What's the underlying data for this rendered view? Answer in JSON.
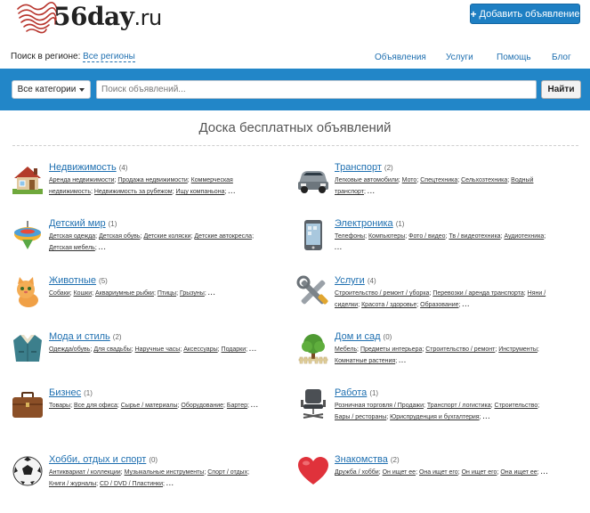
{
  "header": {
    "logo_text": "56day",
    "logo_tld": ".ru",
    "add_button": "Добавить объявление",
    "region_label": "Поиск в регионе:",
    "region_value": "Все регионы"
  },
  "nav": [
    "Объявления",
    "Услуги",
    "Помощь",
    "Блог"
  ],
  "search": {
    "category_button": "Все категории",
    "placeholder": "Поиск объявлений...",
    "submit": "Найти"
  },
  "page_title": "Доска бесплатных объявлений",
  "categories": [
    {
      "icon": "house-icon",
      "title": "Недвижимость",
      "count": "(4)",
      "subs": [
        "Аренда недвижимости",
        "Продажа недвижимости",
        "Коммерческая недвижимость",
        "Недвижимость за рубежом",
        "Ищу компаньона"
      ]
    },
    {
      "icon": "car-icon",
      "title": "Транспорт",
      "count": "(2)",
      "subs": [
        "Легковые автомобили",
        "Мото",
        "Спецтехника",
        "Сельхозтехника",
        "Водный транспорт"
      ]
    },
    {
      "icon": "spinning-top-icon",
      "title": "Детский мир",
      "count": "(1)",
      "subs": [
        "Детская одежда",
        "Детская обувь",
        "Детские коляски",
        "Детские автокресла",
        "Детская мебель"
      ]
    },
    {
      "icon": "smartphone-icon",
      "title": "Электроника",
      "count": "(1)",
      "subs": [
        "Телефоны",
        "Компьютеры",
        "Фото / видео",
        "Тв / видеотехника",
        "Аудиотехника"
      ]
    },
    {
      "icon": "kitten-icon",
      "title": "Животные",
      "count": "(5)",
      "subs": [
        "Собаки",
        "Кошки",
        "Аквариумные рыбки",
        "Птицы",
        "Грызуны"
      ]
    },
    {
      "icon": "tools-icon",
      "title": "Услуги",
      "count": "(4)",
      "subs": [
        "Строительство / ремонт / уборка",
        "Перевозки / аренда транспорта",
        "Няни / сиделки",
        "Красота / здоровье",
        "Образование"
      ]
    },
    {
      "icon": "jacket-icon",
      "title": "Мода и стиль",
      "count": "(2)",
      "subs": [
        "Одежда/обувь",
        "Для свадьбы",
        "Наручные часы",
        "Аксессуары",
        "Подарки"
      ]
    },
    {
      "icon": "tree-icon",
      "title": "Дом и сад",
      "count": "(0)",
      "subs": [
        "Мебель",
        "Предметы интерьера",
        "Строительство / ремонт",
        "Инструменты",
        "Комнатные растения"
      ]
    },
    {
      "icon": "briefcase-icon",
      "title": "Бизнес",
      "count": "(1)",
      "subs": [
        "Товары",
        "Все для офиса",
        "Сырье / материалы",
        "Оборудование",
        "Бартер"
      ]
    },
    {
      "icon": "office-chair-icon",
      "title": "Работа",
      "count": "(1)",
      "subs": [
        "Розничная торговля / Продажи",
        "Транспорт / логистика",
        "Строительство",
        "Бары / рестораны",
        "Юриспруденция и бухгалтерия"
      ]
    },
    {
      "icon": "soccer-ball-icon",
      "title": "Хобби, отдых и спорт",
      "count": "(0)",
      "subs": [
        "Антиквариат / коллекции",
        "Музыкальные инструменты",
        "Спорт / отдых",
        "Книги / журналы",
        "CD / DVD / Пластинки"
      ]
    },
    {
      "icon": "heart-icon",
      "title": "Знакомства",
      "count": "(2)",
      "subs": [
        "Дружба / хобби",
        "Он ищет ее",
        "Она ищет его",
        "Он ищет его",
        "Она ищет ее"
      ]
    }
  ],
  "more_marker": "..."
}
